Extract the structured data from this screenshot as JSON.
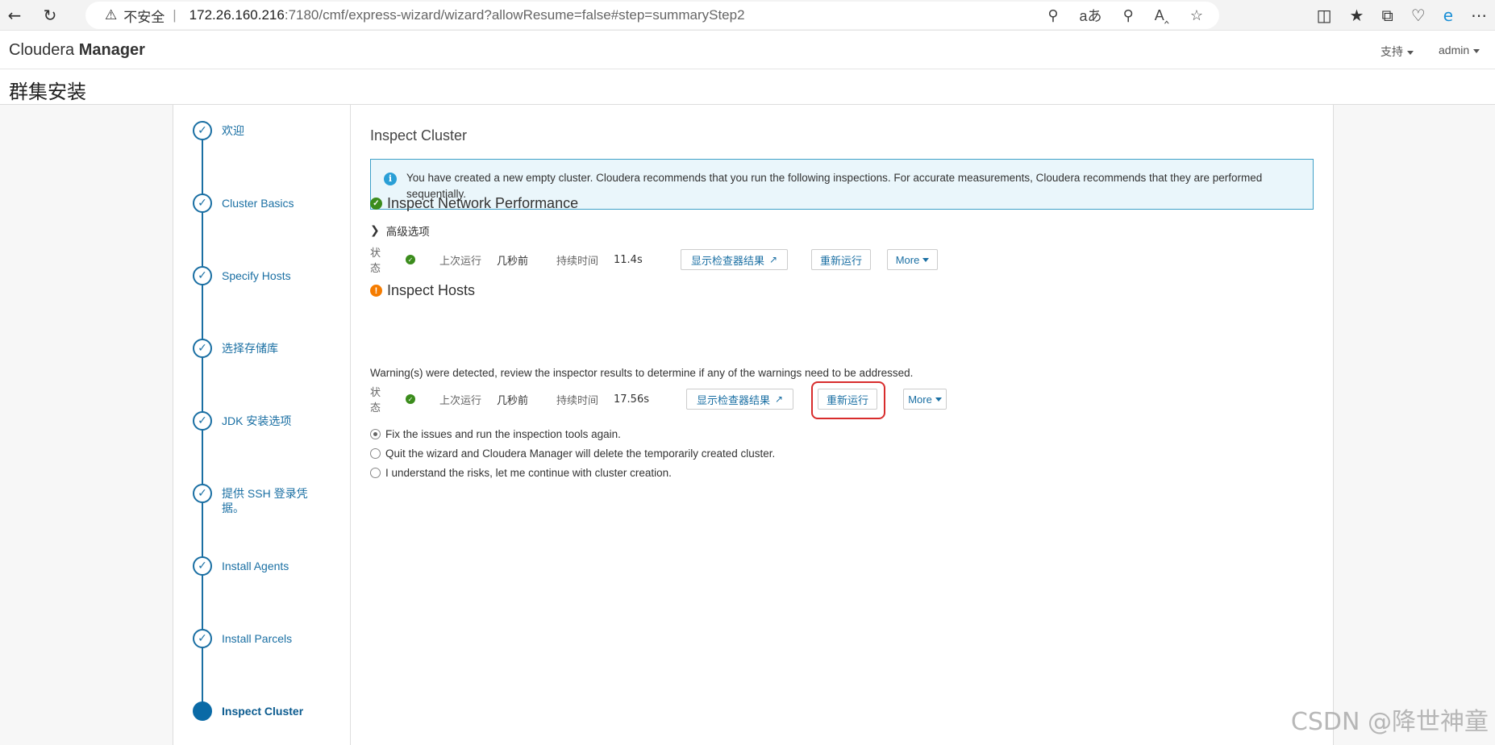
{
  "browser": {
    "insecure_label": "不安全",
    "separator": "|",
    "url_host": "172.26.160.216",
    "url_rest": ":7180/cmf/express-wizard/wizard?allowResume=false#step=summaryStep2"
  },
  "header": {
    "brand_light": "Cloudera ",
    "brand_bold": "Manager",
    "support": "支持",
    "user": "admin"
  },
  "page": {
    "title": "群集安装"
  },
  "steps": [
    {
      "label": "欢迎",
      "done": true
    },
    {
      "label": "Cluster Basics",
      "done": true
    },
    {
      "label": "Specify Hosts",
      "done": true
    },
    {
      "label": "选择存储库",
      "done": true
    },
    {
      "label": "JDK 安装选项",
      "done": true
    },
    {
      "label": "提供 SSH 登录凭据。",
      "done": true
    },
    {
      "label": "Install Agents",
      "done": true
    },
    {
      "label": "Install Parcels",
      "done": true
    },
    {
      "label": "Inspect Cluster",
      "done": false
    }
  ],
  "main": {
    "title": "Inspect Cluster",
    "info": "You have created a new empty cluster. Cloudera recommends that you run the following inspections. For accurate measurements, Cloudera recommends that they are performed sequentially.",
    "network": {
      "title": "Inspect Network Performance",
      "advanced": "高级选项",
      "status_label": "状态",
      "last_run_label": "上次运行",
      "last_run": "几秒前",
      "duration_label": "持续时间",
      "duration": "11.4s",
      "show_results": "显示检查器结果",
      "rerun": "重新运行",
      "more": "More"
    },
    "hosts": {
      "title": "Inspect Hosts",
      "warning": "Warning(s) were detected, review the inspector results to determine if any of the warnings need to be addressed.",
      "status_label": "状态",
      "last_run_label": "上次运行",
      "last_run": "几秒前",
      "duration_label": "持续时间",
      "duration": "17.56s",
      "show_results": "显示检查器结果",
      "rerun": "重新运行",
      "more": "More"
    },
    "options": [
      "Fix the issues and run the inspection tools again.",
      "Quit the wizard and Cloudera Manager will delete the temporarily created cluster.",
      "I understand the risks, let me continue with cluster creation."
    ],
    "selected_option": 0
  },
  "watermark": "CSDN @降世神童",
  "colors": {
    "accent": "#1a6fa3",
    "success": "#3b8c1c",
    "warning": "#f57c00",
    "highlight": "#d82c2c"
  }
}
